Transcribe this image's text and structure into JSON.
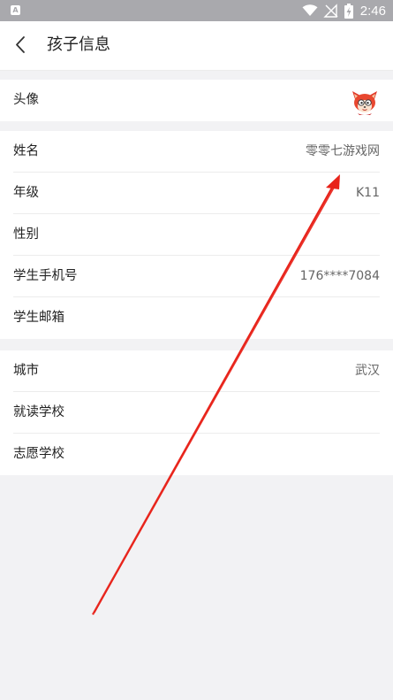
{
  "status_bar": {
    "time": "2:46",
    "app_icon_letter": "A",
    "icons": [
      "wifi-icon",
      "signal-off-icon",
      "battery-charging-icon"
    ]
  },
  "header": {
    "title": "孩子信息",
    "back_icon": "chevron-left-icon"
  },
  "profile": {
    "avatar_label": "头像",
    "avatar_icon": "cartoon-fox-avatar"
  },
  "basic_info": [
    {
      "label": "姓名",
      "value": "零零七游戏网"
    },
    {
      "label": "年级",
      "value": "K11"
    },
    {
      "label": "性别",
      "value": ""
    },
    {
      "label": "学生手机号",
      "value": "176****7084"
    },
    {
      "label": "学生邮箱",
      "value": ""
    }
  ],
  "school_info": [
    {
      "label": "城市",
      "value": "武汉"
    },
    {
      "label": "就读学校",
      "value": ""
    },
    {
      "label": "志愿学校",
      "value": ""
    }
  ],
  "colors": {
    "background": "#f2f2f4",
    "status_bar": "#a9a9ad",
    "annotation_arrow": "#e8231a",
    "value_text": "#666666"
  }
}
